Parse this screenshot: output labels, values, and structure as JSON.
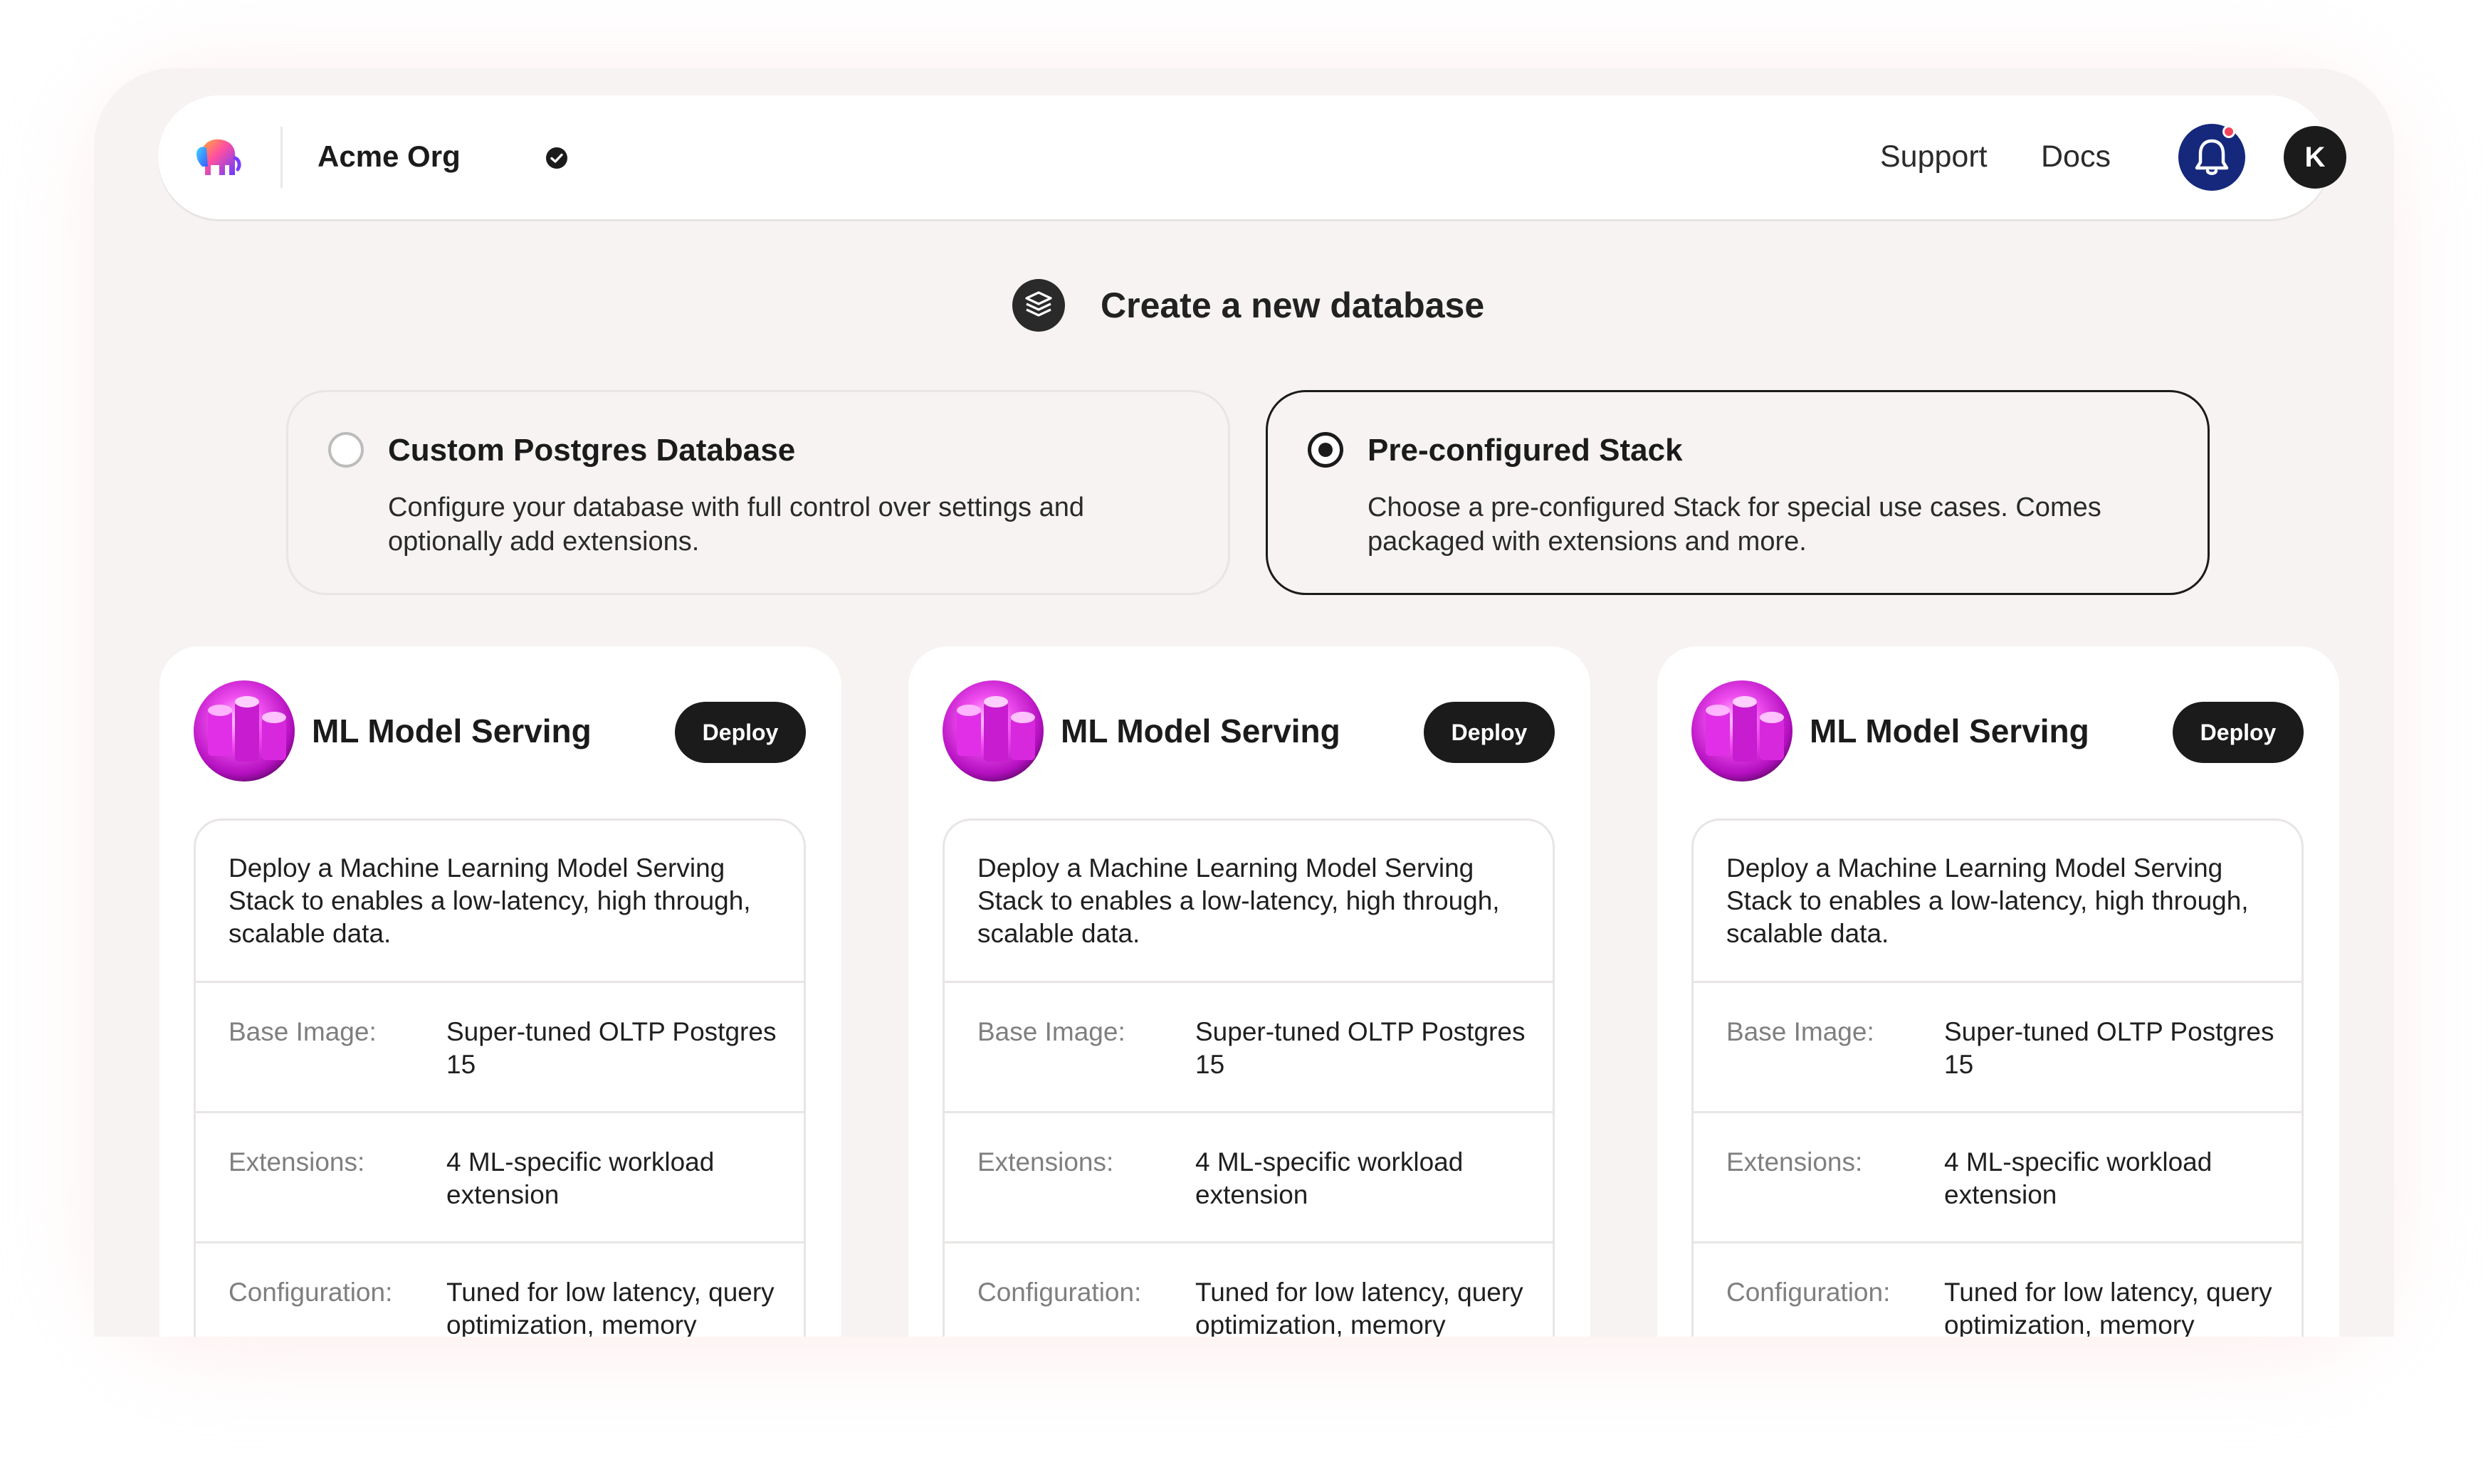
{
  "header": {
    "org_name": "Acme Org",
    "logo_icon": "elephant-logo-icon",
    "verified_icon": "check-badge-icon",
    "nav": {
      "support": "Support",
      "docs": "Docs"
    },
    "notifications_icon": "bell-icon",
    "avatar_initial": "K"
  },
  "page": {
    "title": "Create a new database",
    "title_icon": "stack-layers-icon"
  },
  "options": {
    "custom": {
      "title": "Custom Postgres Database",
      "description": "Configure your database with full control over settings and optionally add extensions.",
      "selected": false
    },
    "stack": {
      "title": "Pre-configured Stack",
      "description": "Choose a pre-configured Stack for special use cases. Comes packaged with extensions and more.",
      "selected": true
    }
  },
  "stacks": [
    {
      "title": "ML Model Serving",
      "deploy_label": "Deploy",
      "description": "Deploy a Machine Learning Model Serving Stack to enables a low-latency, high through, scalable data.",
      "rows": [
        {
          "label": "Base Image:",
          "value": "Super-tuned OLTP Postgres 15"
        },
        {
          "label": "Extensions:",
          "value": "4 ML-specific workload extension"
        },
        {
          "label": "Configuration:",
          "value": "Tuned for low latency, query optimization, memory"
        }
      ]
    },
    {
      "title": "ML Model Serving",
      "deploy_label": "Deploy",
      "description": "Deploy a Machine Learning Model Serving Stack to enables a low-latency, high through, scalable data.",
      "rows": [
        {
          "label": "Base Image:",
          "value": "Super-tuned OLTP Postgres 15"
        },
        {
          "label": "Extensions:",
          "value": "4 ML-specific workload extension"
        },
        {
          "label": "Configuration:",
          "value": "Tuned for low latency, query optimization, memory"
        }
      ]
    },
    {
      "title": "ML Model Serving",
      "deploy_label": "Deploy",
      "description": "Deploy a Machine Learning Model Serving Stack to enables a low-latency, high through, scalable data.",
      "rows": [
        {
          "label": "Base Image:",
          "value": "Super-tuned OLTP Postgres 15"
        },
        {
          "label": "Extensions:",
          "value": "4 ML-specific workload extension"
        },
        {
          "label": "Configuration:",
          "value": "Tuned for low latency, query optimization, memory"
        }
      ]
    }
  ],
  "colors": {
    "background": "#f6f3f2",
    "accent_dark": "#1b1b1b",
    "bell_button": "#15287c",
    "notification_dot": "#f2455c",
    "thumbnail_magenta": "#d21bd6"
  }
}
